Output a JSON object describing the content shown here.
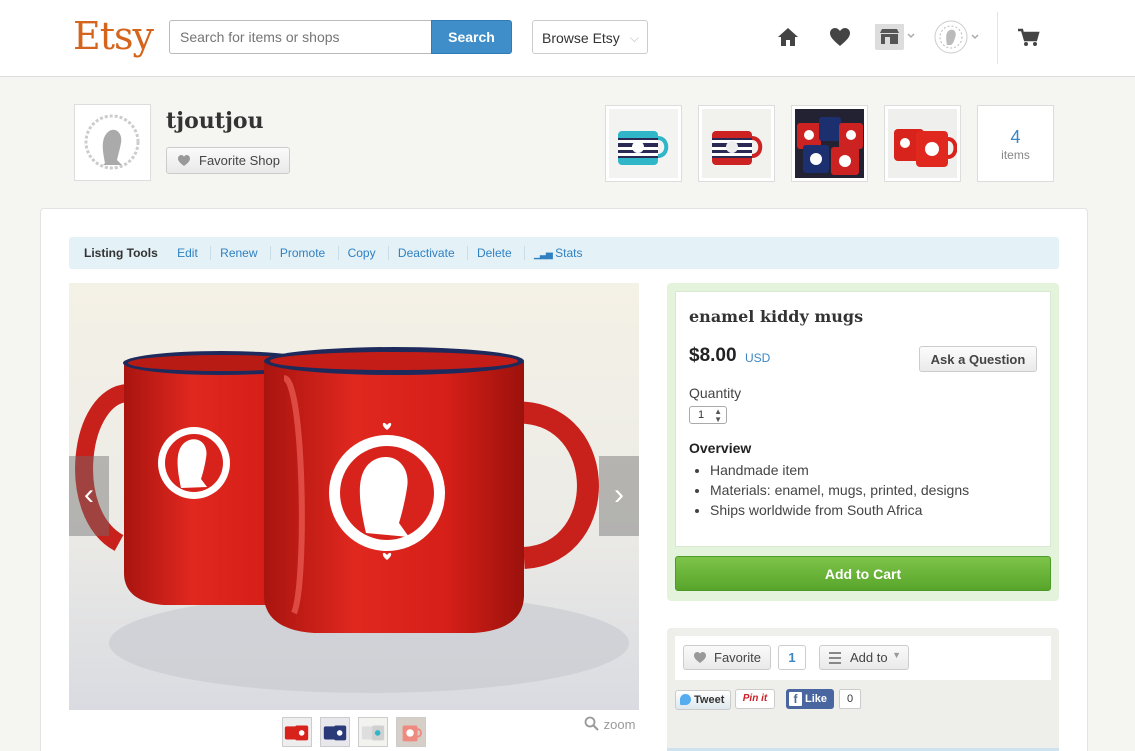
{
  "header": {
    "logo": "Etsy",
    "search_placeholder": "Search for items or shops",
    "search_button": "Search",
    "browse_label": "Browse Etsy",
    "icons": [
      "home-icon",
      "heart-icon",
      "shop-icon",
      "user-avatar-icon",
      "cart-icon"
    ]
  },
  "shop": {
    "name": "tjoutjou",
    "favorite_label": "Favorite Shop",
    "items_count": "4",
    "items_label": "items"
  },
  "listing_tools": {
    "label": "Listing Tools",
    "links": [
      "Edit",
      "Renew",
      "Promote",
      "Copy",
      "Deactivate",
      "Delete",
      "Stats"
    ]
  },
  "listing": {
    "title": "enamel kiddy mugs",
    "price": "$8.00",
    "currency": "USD",
    "ask_label": "Ask a Question",
    "quantity_label": "Quantity",
    "quantity_value": "1",
    "overview_title": "Overview",
    "overview": [
      "Handmade item",
      "Materials: enamel, mugs, printed, designs",
      "Ships worldwide from South Africa"
    ],
    "add_to_cart": "Add to Cart",
    "zoom_label": "zoom"
  },
  "social": {
    "favorite_label": "Favorite",
    "favorite_count": "1",
    "add_to_label": "Add to",
    "tweet": "Tweet",
    "pinit": "Pin it",
    "like": "Like",
    "like_count": "0"
  },
  "colors": {
    "brand": "#d5641c",
    "link": "#2f81c3",
    "cart_green": "#59a52b",
    "mug_red": "#d8231d"
  }
}
